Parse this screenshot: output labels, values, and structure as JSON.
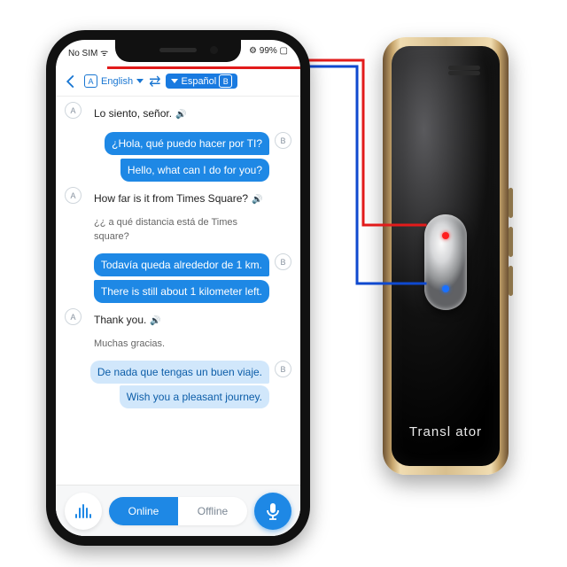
{
  "status": {
    "left": "No SIM ᯤ",
    "right": "⚙ 99% ▢"
  },
  "languages": {
    "a_badge": "A",
    "a_name": "English",
    "b_name": "Español",
    "b_badge": "B"
  },
  "chat": {
    "m1": {
      "text": "Lo siento, señor."
    },
    "m2a": "¿Hola, qué puedo hacer por TI?",
    "m2b": "Hello, what can I do for you?",
    "m3a": "How far is it from Times Square?",
    "m3b": "¿¿ a qué distancia está de Times square?",
    "m4a": "Todavía queda alrededor de 1 km.",
    "m4b": "There is still about 1 kilometer left.",
    "m5a": "Thank you.",
    "m5b": "Muchas gracias.",
    "m6a": "De nada que tengas un buen viaje.",
    "m6b": "Wish you a pleasant journey."
  },
  "footer": {
    "online": "Online",
    "offline": "Offline"
  },
  "device": {
    "brand": "Transl ator"
  },
  "avatar": {
    "a": "A",
    "b": "B"
  }
}
